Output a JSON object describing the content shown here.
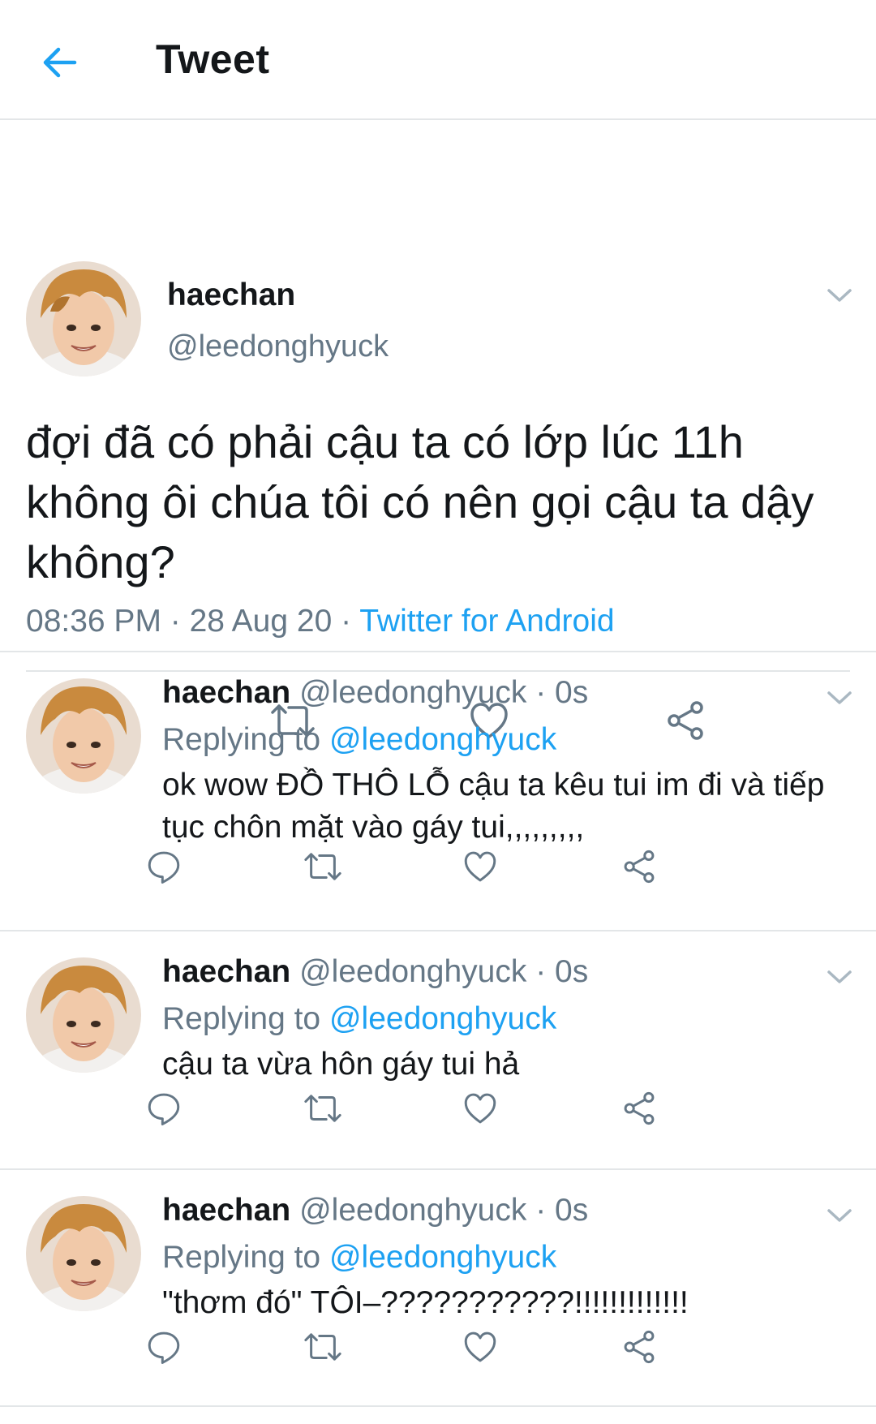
{
  "header": {
    "back_icon": "arrow-left-icon",
    "title": "Tweet"
  },
  "main_tweet": {
    "name": "haechan",
    "handle": "@leedonghyuck",
    "text": "đợi đã có phải cậu ta có lớp lúc 11h không ôi chúa tôi có nên gọi cậu ta dậy không?",
    "time": "08:36 PM",
    "date": "28 Aug 20",
    "source": "Twitter for Android",
    "separator": " · "
  },
  "replies": [
    {
      "name": "haechan",
      "handle": "@leedonghyuck",
      "age": "· 0s",
      "replying_label": "Replying to ",
      "replying_to": "@leedonghyuck",
      "text": "ok wow ĐỒ THÔ LỖ cậu ta kêu tui im đi và tiếp tục chôn mặt vào gáy tui,,,,,,,,,"
    },
    {
      "name": "haechan",
      "handle": "@leedonghyuck",
      "age": "· 0s",
      "replying_label": "Replying to ",
      "replying_to": "@leedonghyuck",
      "text": "cậu ta vừa hôn gáy tui hả"
    },
    {
      "name": "haechan",
      "handle": "@leedonghyuck",
      "age": "· 0s",
      "replying_label": "Replying to ",
      "replying_to": "@leedonghyuck",
      "text": "\"thơm đó\" TÔI–???????????!!!!!!!!!!!!!"
    }
  ],
  "colors": {
    "accent": "#1da1f2",
    "muted": "#657786",
    "text": "#14171a",
    "divider": "#e3e6e8"
  }
}
